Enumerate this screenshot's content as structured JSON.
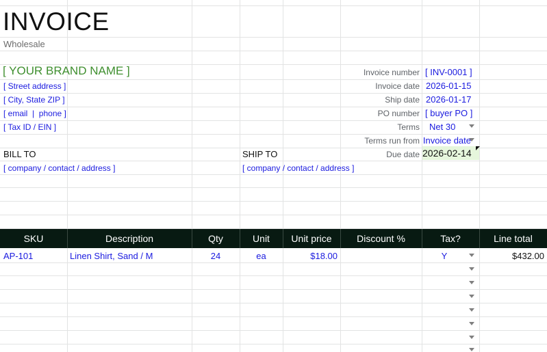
{
  "title": "INVOICE",
  "subtitle": "Wholesale",
  "brand": "[ YOUR BRAND NAME ]",
  "seller": {
    "street": "[ Street address ]",
    "city": "[ City, State ZIP ]",
    "contact": "[ email  |  phone ]",
    "tax_id": "[ Tax ID / EIN ]"
  },
  "meta": {
    "invoice_number_label": "Invoice number",
    "invoice_number": "[ INV-0001 ]",
    "invoice_date_label": "Invoice date",
    "invoice_date": "2026-01-15",
    "ship_date_label": "Ship date",
    "ship_date": "2026-01-17",
    "po_number_label": "PO number",
    "po_number": "[ buyer PO ]",
    "terms_label": "Terms",
    "terms": "Net 30",
    "terms_run_from_label": "Terms run from",
    "terms_run_from": "Invoice date",
    "due_date_label": "Due date",
    "due_date": "2026-02-14"
  },
  "bill_to": {
    "label": "BILL TO",
    "value": "[ company / contact / address ]"
  },
  "ship_to": {
    "label": "SHIP TO",
    "value": "[ company / contact / address ]"
  },
  "table": {
    "headers": {
      "sku": "SKU",
      "description": "Description",
      "qty": "Qty",
      "unit": "Unit",
      "unit_price": "Unit price",
      "discount": "Discount %",
      "tax": "Tax?",
      "line_total": "Line total"
    },
    "rows": [
      {
        "sku": "AP-101",
        "description": "Linen Shirt, Sand / M",
        "qty": "24",
        "unit": "ea",
        "unit_price": "$18.00",
        "discount": "",
        "tax": "Y",
        "line_total": "$432.00"
      }
    ]
  },
  "colors": {
    "header_bg": "#081a12",
    "input_blue": "#1a1adf",
    "brand_green": "#3f8f2f",
    "due_highlight": "#e6f6dc"
  }
}
